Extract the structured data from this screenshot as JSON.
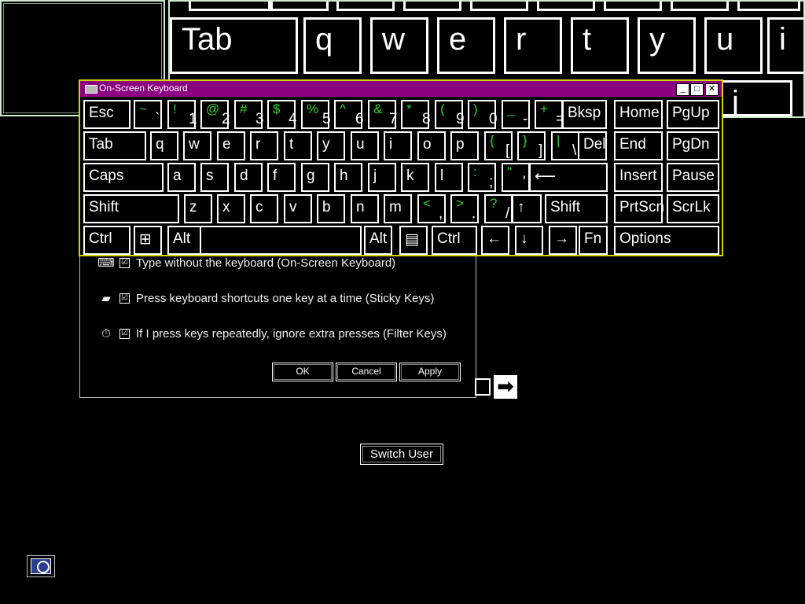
{
  "big_keyboard": {
    "keys": [
      "Tab",
      "q",
      "w",
      "e",
      "r",
      "t",
      "y",
      "u",
      "i",
      "j"
    ]
  },
  "osk": {
    "title": "On-Screen Keyboard",
    "title_buttons": [
      "_",
      "□",
      "✕"
    ],
    "rows": [
      [
        {
          "label": "Esc"
        },
        {
          "sec": "~",
          "pri": "`"
        },
        {
          "sec": "!",
          "pri": "1"
        },
        {
          "sec": "@",
          "pri": "2"
        },
        {
          "sec": "#",
          "pri": "3"
        },
        {
          "sec": "$",
          "pri": "4"
        },
        {
          "sec": "%",
          "pri": "5"
        },
        {
          "sec": "^",
          "pri": "6"
        },
        {
          "sec": "&",
          "pri": "7"
        },
        {
          "sec": "*",
          "pri": "8"
        },
        {
          "sec": "(",
          "pri": "9"
        },
        {
          "sec": ")",
          "pri": "0"
        },
        {
          "sec": "_",
          "pri": "-"
        },
        {
          "sec": "+",
          "pri": "="
        },
        {
          "label": "Bksp"
        },
        {
          "label": "Home"
        },
        {
          "label": "PgUp"
        }
      ],
      [
        {
          "label": "Tab"
        },
        {
          "label": "q"
        },
        {
          "label": "w"
        },
        {
          "label": "e"
        },
        {
          "label": "r"
        },
        {
          "label": "t"
        },
        {
          "label": "y"
        },
        {
          "label": "u"
        },
        {
          "label": "i"
        },
        {
          "label": "o"
        },
        {
          "label": "p"
        },
        {
          "sec": "{",
          "pri": "["
        },
        {
          "sec": "}",
          "pri": "]"
        },
        {
          "sec": "|",
          "pri": "\\"
        },
        {
          "label": "Del"
        },
        {
          "label": "End"
        },
        {
          "label": "PgDn"
        }
      ],
      [
        {
          "label": "Caps"
        },
        {
          "label": "a"
        },
        {
          "label": "s"
        },
        {
          "label": "d"
        },
        {
          "label": "f"
        },
        {
          "label": "g"
        },
        {
          "label": "h"
        },
        {
          "label": "j"
        },
        {
          "label": "k"
        },
        {
          "label": "l"
        },
        {
          "sec": ":",
          "pri": ";"
        },
        {
          "sec": "\"",
          "pri": "'"
        },
        {
          "label": "⟵"
        },
        {
          "label": "Insert"
        },
        {
          "label": "Pause"
        }
      ],
      [
        {
          "label": "Shift"
        },
        {
          "label": "z"
        },
        {
          "label": "x"
        },
        {
          "label": "c"
        },
        {
          "label": "v"
        },
        {
          "label": "b"
        },
        {
          "label": "n"
        },
        {
          "label": "m"
        },
        {
          "sec": "<",
          "pri": ","
        },
        {
          "sec": ">",
          "pri": "."
        },
        {
          "sec": "?",
          "pri": "/"
        },
        {
          "label": "↑"
        },
        {
          "label": "Shift"
        },
        {
          "label": "PrtScn"
        },
        {
          "label": "ScrLk"
        }
      ],
      [
        {
          "label": "Ctrl"
        },
        {
          "label": "⊞"
        },
        {
          "label": "Alt"
        },
        {
          "label": ""
        },
        {
          "label": "Alt"
        },
        {
          "label": "▤"
        },
        {
          "label": "Ctrl"
        },
        {
          "label": "←"
        },
        {
          "label": "↓"
        },
        {
          "label": "→"
        },
        {
          "label": "Fn"
        },
        {
          "label": "Options"
        }
      ]
    ]
  },
  "dialog": {
    "options": [
      {
        "icon": "keyboard-icon",
        "checked": "☑",
        "label": "Type without the keyboard (On-Screen Keyboard)"
      },
      {
        "icon": "sticky-keys-icon",
        "checked": "☑",
        "label": "Press keyboard shortcuts one key at a time (Sticky Keys)"
      },
      {
        "icon": "stopwatch-icon",
        "checked": "☑",
        "label": "If I press keys repeatedly, ignore extra presses (Filter Keys)"
      }
    ],
    "buttons": {
      "ok": "OK",
      "cancel": "Cancel",
      "apply": "Apply"
    }
  },
  "login": {
    "arrow_glyph": "➡",
    "switch_user_label": "Switch User"
  },
  "ease_of_access_icon": "ease-of-access-icon"
}
